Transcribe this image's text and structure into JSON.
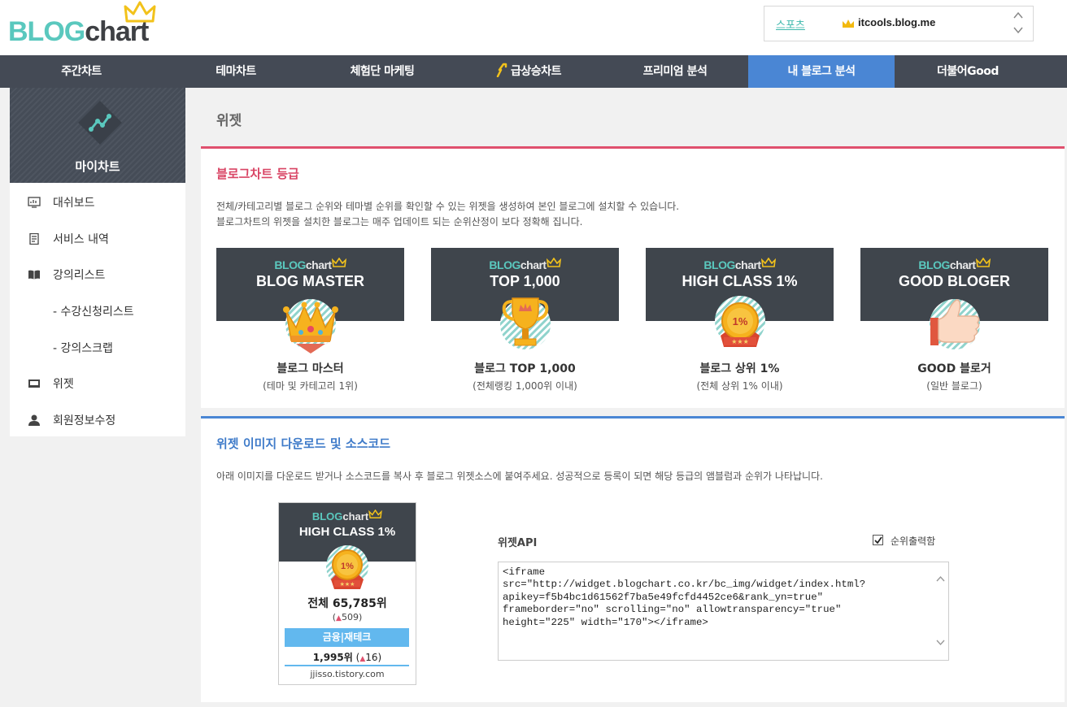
{
  "header": {
    "logo_blog": "BLOG",
    "logo_chart": "chart",
    "category": "스포츠",
    "blog": "itcools.blog.me"
  },
  "nav": [
    "주간차트",
    "테마차트",
    "체험단 마케팅",
    "급상승차트",
    "프리미엄 분석",
    "내 블로그 분석",
    "더불어Good"
  ],
  "nav_active_index": 5,
  "sidebar": {
    "title": "마이차트",
    "items": [
      {
        "label": "대쉬보드",
        "icon": "dashboard-icon"
      },
      {
        "label": "서비스 내역",
        "icon": "document-icon"
      },
      {
        "label": "강의리스트",
        "icon": "book-icon"
      },
      {
        "label": "- 수강신청리스트",
        "icon": ""
      },
      {
        "label": "- 강의스크랩",
        "icon": ""
      },
      {
        "label": "위젯",
        "icon": "widget-icon"
      },
      {
        "label": "회원정보수정",
        "icon": "user-icon"
      }
    ]
  },
  "main": {
    "title": "위젯",
    "grade": {
      "title": "블로그차트 등급",
      "desc1": "전체/카테고리별 블로그 순위와 테마별 순위를 확인할 수 있는 위젯을 생성하여 본인 블로그에 설치할 수 있습니다.",
      "desc2": "블로그차트의 위젯을 설치한 블로그는 매주 업데이트 되는 순위산정이 보다 정확해 집니다.",
      "badges": [
        {
          "name": "BLOG MASTER",
          "label": "블로그 마스터",
          "sub": "(테마 및 카테고리 1위)",
          "emblem": "crown-emblem"
        },
        {
          "name": "TOP 1,000",
          "label": "블로그 TOP 1,000",
          "sub": "(전체랭킹 1,000위 이내)",
          "emblem": "trophy-emblem"
        },
        {
          "name": "HIGH CLASS 1%",
          "label": "블로그 상위 1%",
          "sub": "(전체 상위 1% 이내)",
          "emblem": "medal-emblem"
        },
        {
          "name": "GOOD BLOGER",
          "label": "GOOD 블로거",
          "sub": "(일반 블로그)",
          "emblem": "thumbs-up-emblem"
        }
      ]
    },
    "download": {
      "title": "위젯 이미지 다운로드 및 소스코드",
      "desc": "아래 이미지를 다운로드 받거나 소스코드를 복사 후 블로그 위젯소스에 붙여주세요. 성공적으로 등록이 되면 해당 등급의 앰블럼과 순위가 나타납니다.",
      "widget": {
        "title": "HIGH CLASS 1%",
        "medal_text": "1%",
        "rank": "전체 65,785위",
        "change_open": "(",
        "change_arrow": "▲",
        "change": "509",
        "change_close": ")",
        "category": "금융|재테크",
        "cat_rank": "1,995위",
        "cat_change_open": "(",
        "cat_change_arrow": "▲",
        "cat_change": "16",
        "cat_change_close": ")",
        "blog": "jjisso.tistory.com"
      },
      "api_label": "위젯API",
      "checkbox_label": "순위출력함",
      "checkbox_checked": true,
      "code": "<iframe\nsrc=\"http://widget.blogchart.co.kr/bc_img/widget/index.html?\napikey=f5b4bc1d61562f7ba5e49fcfd4452ce6&rank_yn=true\"\nframeborder=\"no\" scrolling=\"no\" allowtransparency=\"true\"\nheight=\"225\" width=\"170\"></iframe>"
    }
  },
  "colors": {
    "nav_bg": "#444a55",
    "nav_active": "#4a86d4",
    "accent_red": "#e0506e",
    "accent_blue": "#4a86d4",
    "mint": "#5ac8be",
    "badge_bg": "#3f454c"
  }
}
